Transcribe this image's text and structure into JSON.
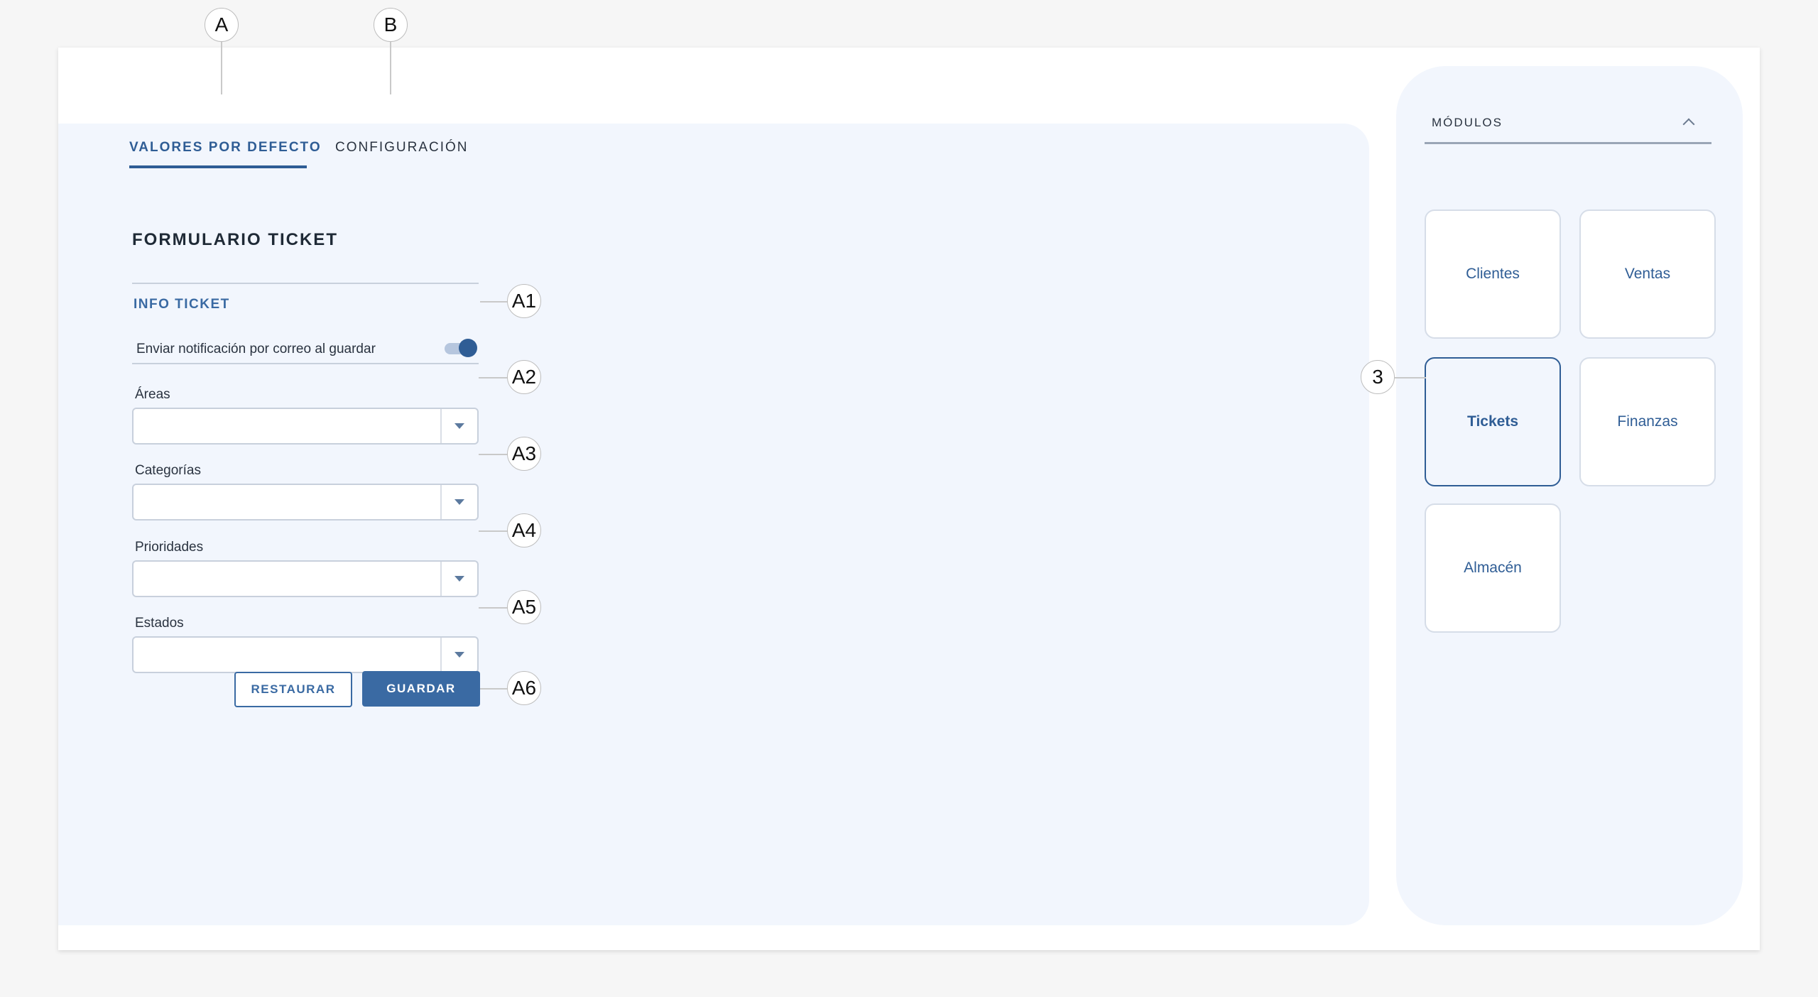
{
  "tabs": [
    {
      "label": "VALORES POR DEFECTO",
      "active": true
    },
    {
      "label": "CONFIGURACIÓN",
      "active": false
    }
  ],
  "form": {
    "title": "FORMULARIO TICKET",
    "section": "INFO TICKET",
    "notify_label": "Enviar notificación por correo al guardar",
    "notify_enabled": true,
    "fields": [
      {
        "label": "Áreas",
        "value": ""
      },
      {
        "label": "Categorías",
        "value": ""
      },
      {
        "label": "Prioridades",
        "value": ""
      },
      {
        "label": "Estados",
        "value": ""
      }
    ],
    "restore_label": "RESTAURAR",
    "save_label": "GUARDAR"
  },
  "modules": {
    "title": "MÓDULOS",
    "items": [
      {
        "label": "Clientes",
        "active": false
      },
      {
        "label": "Ventas",
        "active": false
      },
      {
        "label": "Tickets",
        "active": true
      },
      {
        "label": "Finanzas",
        "active": false
      },
      {
        "label": "Almacén",
        "active": false
      }
    ]
  },
  "callouts": {
    "a": "A",
    "b": "B",
    "a1": "A1",
    "a2": "A2",
    "a3": "A3",
    "a4": "A4",
    "a5": "A5",
    "a6": "A6",
    "three": "3"
  },
  "colors": {
    "accent": "#2f5d95",
    "panel_bg": "#f2f6fd",
    "page_bg": "#f6f6f6"
  }
}
